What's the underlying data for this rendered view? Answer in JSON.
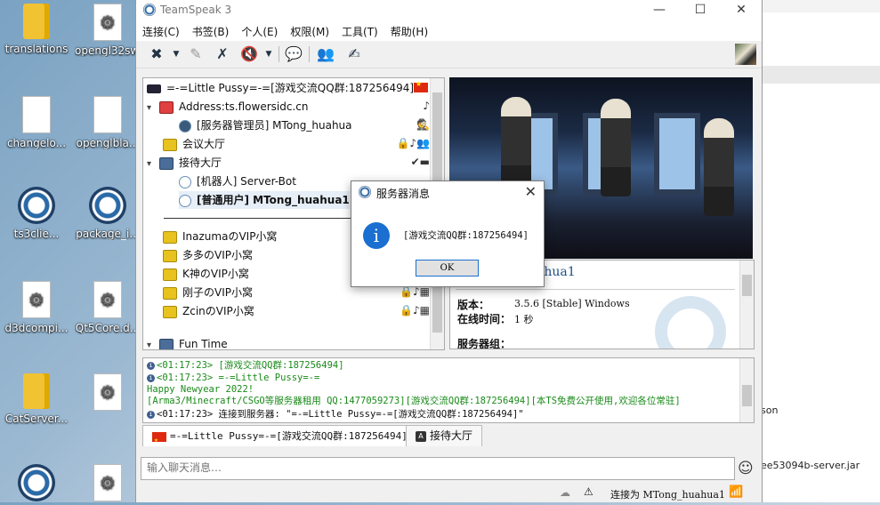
{
  "desktop": {
    "icons": [
      {
        "label": "translations"
      },
      {
        "label": "opengl32sw."
      },
      {
        "label": "changelo..."
      },
      {
        "label": "openglbla..."
      },
      {
        "label": "ts3clie..."
      },
      {
        "label": "package_i..."
      },
      {
        "label": "d3dcompi..."
      },
      {
        "label": "Qt5Core.d..."
      },
      {
        "label": "CatServer..."
      }
    ],
    "right_text": {
      "line1": "son",
      "line2": "ee53094b-server.jar"
    }
  },
  "window": {
    "title": "TeamSpeak 3",
    "controls": {
      "minimize": "—",
      "maximize": "☐",
      "close": "✕"
    }
  },
  "menu": [
    "连接(C)",
    "书签(B)",
    "个人(E)",
    "权限(M)",
    "工具(T)",
    "帮助(H)"
  ],
  "toolbar": {
    "icons": [
      "disconnect-icon",
      "bookmarks-icon",
      "mute-mic-icon",
      "mute-speaker-icon",
      "away-icon",
      "contacts-icon",
      "whisper-icon"
    ]
  },
  "tree": {
    "server": "=-=Little Pussy=-=[游戏交流QQ群:187256494]",
    "items": [
      {
        "type": "channel",
        "label": "Address:ts.flowersidc.cn",
        "expanded": true
      },
      {
        "type": "user",
        "label": "[服务器管理员] MTong_huahua"
      },
      {
        "type": "channel",
        "label": "会议大厅"
      },
      {
        "type": "channel",
        "label": "接待大厅",
        "expanded": true
      },
      {
        "type": "user",
        "label": "[机器人] Server-Bot"
      },
      {
        "type": "user",
        "label": "[普通用户] MTong_huahua1",
        "bold": true
      },
      {
        "type": "channel",
        "label": "InazumaのVIP小窝"
      },
      {
        "type": "channel",
        "label": "多多のVIP小窝"
      },
      {
        "type": "channel",
        "label": "K神のVIP小窝"
      },
      {
        "type": "channel",
        "label": "刚子のVIP小窝"
      },
      {
        "type": "channel",
        "label": "ZcinのVIP小窝"
      },
      {
        "type": "channel",
        "label": "Fun Time"
      }
    ]
  },
  "info": {
    "name": "uahua1",
    "version_label": "版本：",
    "version_value": "3.5.6 [Stable] Windows",
    "online_label": "在线时间：",
    "online_value": "1 秒",
    "group_label": "服务器组："
  },
  "chat": {
    "lines": [
      "<01:17:23> [游戏交流QQ群:187256494]",
      "<01:17:23> =-=Little Pussy=-=",
      "Happy Newyear 2022!",
      "[Arma3/Minecraft/CSGO等服务器租用 QQ:1477059273][游戏交流QQ群:187256494][本TS免费公开使用,欢迎各位常驻]",
      "<01:17:23> 连接到服务器: \"=-=Little Pussy=-=[游戏交流QQ群:187256494]\""
    ],
    "tabs": [
      "=-=Little Pussy=-=[游戏交流QQ群:187256494]",
      "接待大厅"
    ],
    "input_placeholder": "输入聊天消息…"
  },
  "status": {
    "connected": "连接为 MTong_huahua1"
  },
  "dialog": {
    "title": "服务器消息",
    "message": "[游戏交流QQ群:187256494]",
    "ok": "OK"
  }
}
